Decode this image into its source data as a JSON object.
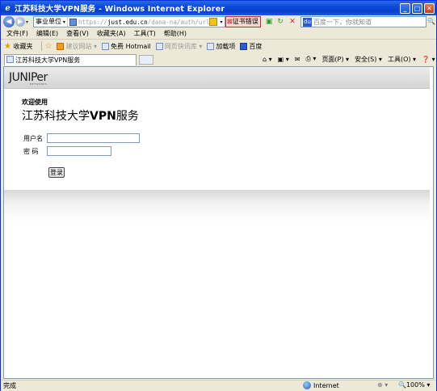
{
  "window": {
    "title": "江苏科技大学VPN服务 - Windows Internet Explorer",
    "buttons": {
      "min": "_",
      "max": "□",
      "close": "✕"
    }
  },
  "addressbar": {
    "zone": "事业单位",
    "url_pre": "https://",
    "url_host": "just.edu.cn",
    "url_post": "/dana-na/auth/url_default/welcome.cgi",
    "cert_error": "证书错误",
    "search_placeholder": "百度一下，你就知道"
  },
  "menu": {
    "items": [
      "文件(F)",
      "编辑(E)",
      "查看(V)",
      "收藏夹(A)",
      "工具(T)",
      "帮助(H)"
    ]
  },
  "favorites": {
    "label": "收藏夹",
    "items": [
      {
        "label": "建议网站 ▾",
        "enabled": false
      },
      {
        "label": "免费 Hotmail",
        "enabled": true
      },
      {
        "label": "网页快讯库 ▾",
        "enabled": false
      },
      {
        "label": "加载项",
        "enabled": true
      },
      {
        "label": "百度",
        "enabled": true
      }
    ]
  },
  "tabs": [
    {
      "label": "江苏科技大学VPN服务"
    }
  ],
  "commandbar": {
    "items": [
      "⌂ ▾",
      "▣ ▾",
      "✉",
      "⎙ ▾",
      "页面(P) ▾",
      "安全(S) ▾",
      "工具(O) ▾",
      "❓ ▾"
    ]
  },
  "page": {
    "logo": "JUNIPer",
    "logo_sub": "NETWORKS",
    "welcome": "欢迎使用",
    "title_pre": "江苏科技大学",
    "title_vpn": "VPN",
    "title_post": "服务",
    "username_label": "用户名",
    "password_label": "密 码",
    "login_button": "登录"
  },
  "statusbar": {
    "status": "完成",
    "zone": "Internet",
    "protected": "⊕ ▾",
    "zoom": "🔍100% ▾"
  }
}
